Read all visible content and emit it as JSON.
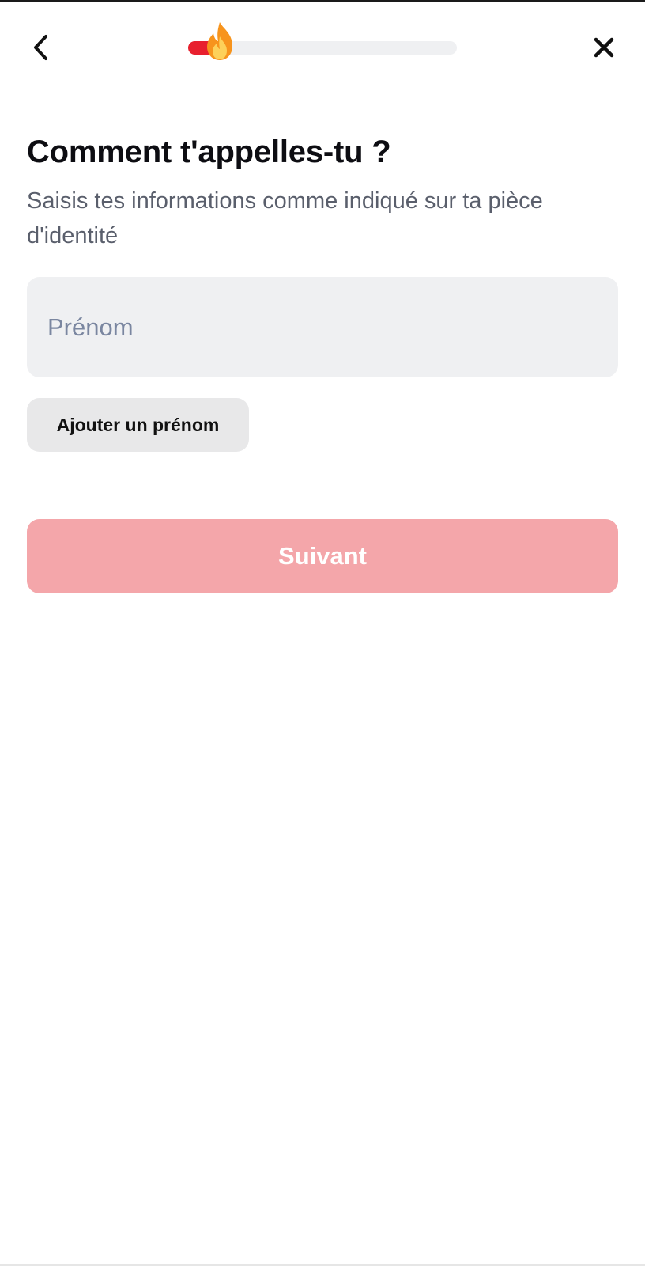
{
  "header": {
    "back_icon": "chevron-left-icon",
    "close_icon": "close-icon",
    "progress": {
      "fraction": 0.1,
      "indicator_icon": "flame-icon"
    }
  },
  "main": {
    "title": "Comment t'appelles-tu ?",
    "subtitle": "Saisis tes informations comme indiqué sur ta pièce d'identité",
    "first_name_field": {
      "value": "",
      "placeholder": "Prénom"
    },
    "add_first_name_label": "Ajouter un prénom",
    "next_label": "Suivant"
  },
  "colors": {
    "accent": "#e8202e",
    "next_disabled": "#f4a6aa",
    "field_background": "#eff0f2",
    "placeholder": "#7a86a0"
  }
}
